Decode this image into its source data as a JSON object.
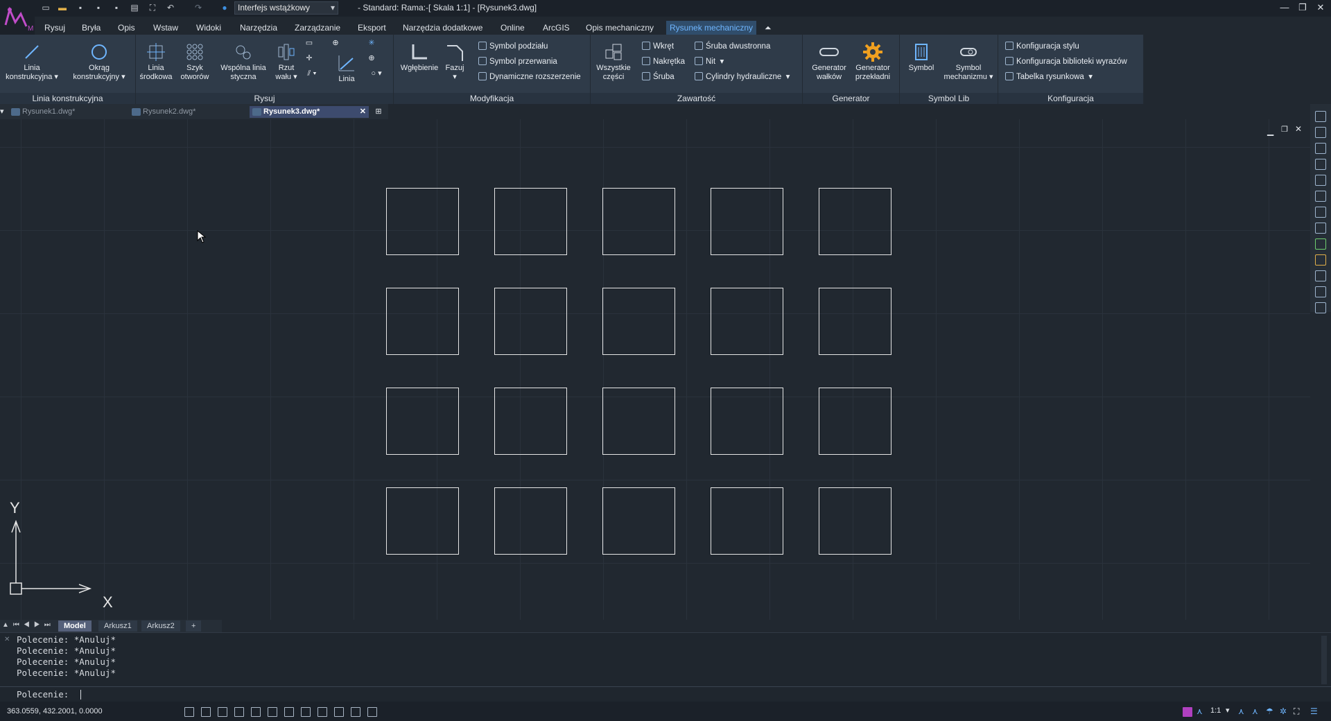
{
  "titlebar": {
    "workspace": "Interfejs wstążkowy",
    "title": "- Standard: Rama:-[ Skala 1:1] - [Rysunek3.dwg]"
  },
  "menu": [
    "Rysuj",
    "Bryła",
    "Opis",
    "Wstaw",
    "Widoki",
    "Narzędzia",
    "Zarządzanie",
    "Eksport",
    "Narzędzia dodatkowe",
    "Online",
    "ArcGIS",
    "Opis mechaniczny",
    "Rysunek mechaniczny"
  ],
  "ribbon": {
    "groups": {
      "linia": "Linia konstrukcyjna",
      "rysuj": "Rysuj",
      "modyfikacja": "Modyfikacja",
      "zawartosc": "Zawartość",
      "generator": "Generator",
      "symbol": "Symbol Lib",
      "konfiguracja": "Konfiguracja"
    },
    "buttons": {
      "linia_konstr": "Linia konstrukcyjna",
      "okrag_konstr": "Okrąg konstrukcyjny",
      "linia_srodkowa": "Linia środkowa",
      "szyk_otworow": "Szyk otworów",
      "wspolna_linia": "Wspólna linia styczna",
      "rzut_walu": "Rzut wału",
      "linia": "Linia",
      "wglebienie": "Wgłębienie",
      "fazuj": "Fazuj",
      "symbol_podzialu": "Symbol podziału",
      "symbol_przerwania": "Symbol przerwania",
      "dynamiczne": "Dynamiczne rozszerzenie",
      "wszystkie_czesci": "Wszystkie części",
      "wkret": "Wkręt",
      "nakretka": "Nakrętka",
      "sruba": "Śruba",
      "sruba_dwustronna": "Śruba dwustronna",
      "nit": "Nit",
      "cylindry": "Cylindry hydrauliczne",
      "gen_walkow": "Generator wałków",
      "gen_przekladni": "Generator przekładni",
      "symbol": "Symbol",
      "symbol_mech": "Symbol mechanizmu",
      "konf_stylu": "Konfiguracja stylu",
      "konf_biblioteki": "Konfiguracja biblioteki wyrazów",
      "tabelka": "Tabelka rysunkowa"
    }
  },
  "doctabs": [
    "Rysunek1.dwg*",
    "Rysunek2.dwg*",
    "Rysunek3.dwg*"
  ],
  "ucs": {
    "x": "X",
    "y": "Y"
  },
  "layouttabs": [
    "Model",
    "Arkusz1",
    "Arkusz2",
    "+"
  ],
  "command": {
    "history": [
      "Polecenie: *Anuluj*",
      "Polecenie: *Anuluj*",
      "Polecenie: *Anuluj*",
      "Polecenie: *Anuluj*"
    ],
    "prompt": "Polecenie:"
  },
  "status": {
    "coords": "363.0559, 432.2001, 0.0000",
    "scale": "1:1"
  },
  "colors": {
    "accent": "#6fb6ff",
    "ribbon": "#2f3b49",
    "canvas": "#212830"
  }
}
